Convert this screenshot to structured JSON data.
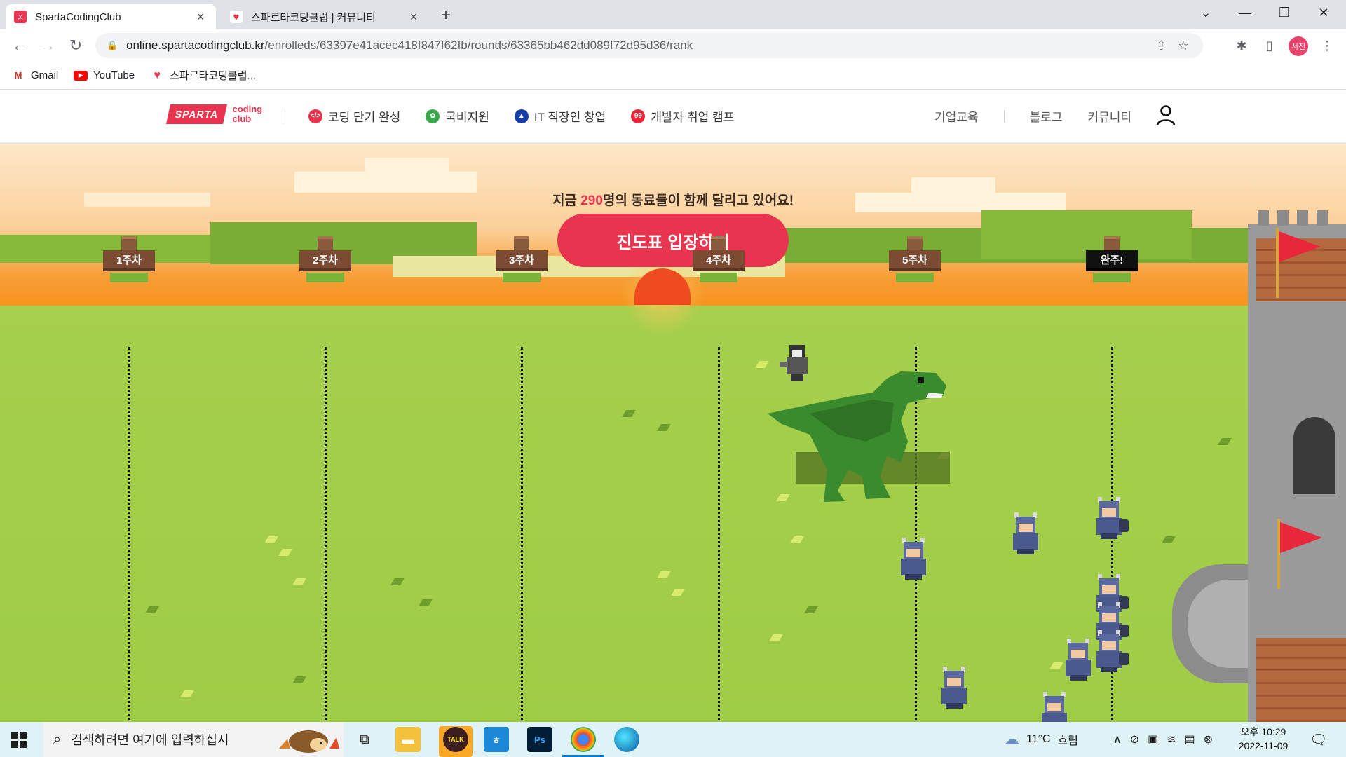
{
  "browser": {
    "tabs": [
      {
        "title": "SpartaCodingClub",
        "active": true
      },
      {
        "title": "스파르타코딩클럽 | 커뮤니티",
        "active": false
      }
    ],
    "new_tab_label": "+",
    "url_host": "online.spartacodingclub.kr",
    "url_path": "/enrolleds/63397e41acec418f847f62fb/rounds/63365bb462dd089f72d95d36/rank",
    "profile_initials": "서진",
    "bookmarks": [
      {
        "label": "Gmail",
        "icon": "gmail-icon"
      },
      {
        "label": "YouTube",
        "icon": "youtube-icon"
      },
      {
        "label": "스파르타코딩클럽...",
        "icon": "sparta-icon"
      }
    ]
  },
  "site": {
    "logo_badge": "SPARTA",
    "logo_sub1": "coding",
    "logo_sub2": "club",
    "nav": [
      {
        "label": "코딩 단기 완성",
        "color": "#e8344e"
      },
      {
        "label": "국비지원",
        "color": "#3aa94b"
      },
      {
        "label": "IT 직장인 창업",
        "color": "#1a3ea8"
      },
      {
        "label": "개발자 취업 캠프",
        "color": "#e8283a"
      }
    ],
    "right_nav": [
      "기업교육",
      "블로그",
      "커뮤니티"
    ]
  },
  "scene": {
    "cta_prefix": "지금 ",
    "cta_count": "290",
    "cta_suffix": "명의 동료들이 함께 달리고 있어요!",
    "cta_button": "진도표 입장하기",
    "weeks": [
      "1주차",
      "2주차",
      "3주차",
      "4주차",
      "5주차",
      "완주!"
    ]
  },
  "taskbar": {
    "search_placeholder": "검색하려면 여기에 입력하십시",
    "weather_temp": "11°C",
    "weather_desc": "흐림",
    "time_label": "오후 10:29",
    "date_label": "2022-11-09",
    "apps": [
      "task-view-icon",
      "file-explorer-icon",
      "kakaotalk-icon",
      "hangul-icon",
      "photoshop-icon",
      "chrome-icon",
      "edge-icon"
    ]
  },
  "colors": {
    "accent": "#e8344e",
    "grass": "#9fcc46",
    "sunset": "#f7931e"
  }
}
